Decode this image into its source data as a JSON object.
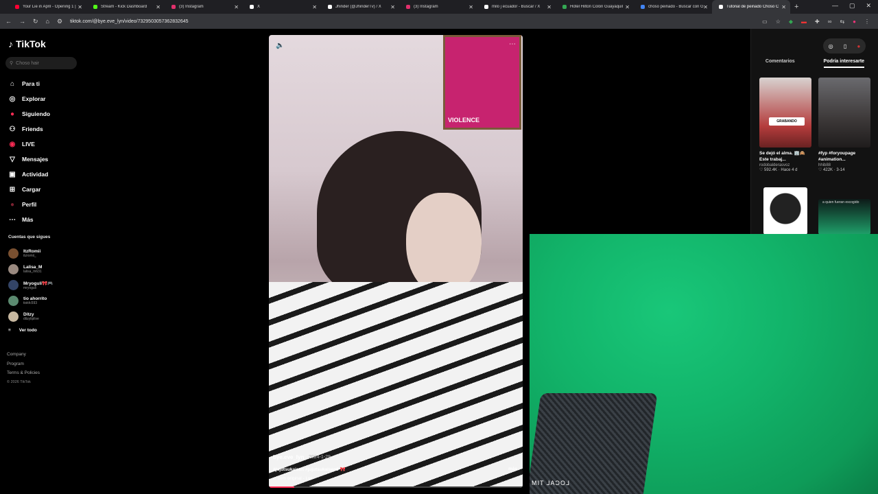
{
  "tabs": [
    {
      "title": "Your Lie in April - Opening 1 |",
      "fav": "#ff0033"
    },
    {
      "title": "Stream - Kick Dashboard",
      "fav": "#53fc18"
    },
    {
      "title": "(3) Instagram",
      "fav": "#e1306c"
    },
    {
      "title": "X",
      "fav": "#ffffff"
    },
    {
      "title": "Jhinder (@JhinderTv) / X",
      "fav": "#ffffff"
    },
    {
      "title": "(3) Instagram",
      "fav": "#e1306c"
    },
    {
      "title": "milo j ecuador - Buscar / X",
      "fav": "#ffffff"
    },
    {
      "title": "Hotel Hilton Colón Guayaquil",
      "fav": "#34a853"
    },
    {
      "title": "choso peinado - Buscar con G",
      "fav": "#4285f4"
    },
    {
      "title": "Tutorial de peinado Choso C",
      "fav": "#ffffff",
      "active": true
    }
  ],
  "address": {
    "url": "tiktok.com/@bye.eve_lyn/video/7329503057362832645"
  },
  "sidebar": {
    "logo": "TikTok",
    "search_placeholder": "Choso hair",
    "nav": [
      {
        "label": "Para ti",
        "icon": "home-icon",
        "glyph": "⌂"
      },
      {
        "label": "Explorar",
        "icon": "compass-icon",
        "glyph": "◎"
      },
      {
        "label": "Siguiendo",
        "icon": "following-icon",
        "glyph": "●"
      },
      {
        "label": "Friends",
        "icon": "friends-icon",
        "glyph": "⚇"
      },
      {
        "label": "LIVE",
        "icon": "live-icon",
        "glyph": "◉"
      },
      {
        "label": "Mensajes",
        "icon": "messages-icon",
        "glyph": "▽"
      },
      {
        "label": "Actividad",
        "icon": "activity-icon",
        "glyph": "▣"
      },
      {
        "label": "Cargar",
        "icon": "upload-icon",
        "glyph": "⊞"
      },
      {
        "label": "Perfil",
        "icon": "profile-icon",
        "glyph": "●"
      },
      {
        "label": "Más",
        "icon": "more-icon",
        "glyph": "⋯"
      }
    ],
    "following_title": "Cuentas que sigues",
    "accounts": [
      {
        "name": "ItzRomii",
        "handle": "itzromii_",
        "color": "#7a5030"
      },
      {
        "name": "Lalisa_M",
        "handle": "lalisa_m631",
        "color": "#9a8a80"
      },
      {
        "name": "Mryoguli🎀🎮",
        "handle": "mryoguli",
        "color": "#334466"
      },
      {
        "name": "tio ahorrito",
        "handle": "tiokfc593",
        "color": "#5b8a70"
      },
      {
        "name": "Ditzy",
        "handle": "ditzyliplive",
        "color": "#c7b8a0"
      }
    ],
    "see_all": "Ver todo",
    "footer": [
      "Company",
      "Program",
      "Terms & Policies"
    ],
    "copyright": "© 2026 TikTok"
  },
  "video": {
    "username": "bye.eve_lyn",
    "date": "2024-1-29",
    "tags": "#jujutsukaisen #jujutsukaisen0 🎀",
    "more": "más",
    "sound": "♫  som original - Lyn",
    "progress": 0.1
  },
  "right_panel": {
    "tabs": [
      "Comentarios",
      "Podría interesarte"
    ],
    "active_tab": 1,
    "cards": [
      {
        "caption": "Se dejó el alma. 🏢🙈 Este trabaj...",
        "author": "rodobalderasvoz",
        "meta": "♡ 592.4K · Hace 4 d",
        "badge": "GRABANDO",
        "color": "#c8c2c0"
      },
      {
        "caption": "#fyp #foryoupage #animation...",
        "author": "hhib88",
        "meta": "♡ 422K · 3-14",
        "color": "#3c3a3a"
      }
    ],
    "second_row_text": "a quien fueran escogido"
  },
  "webcam": {
    "overlay_text": "LOCAL TIM"
  }
}
